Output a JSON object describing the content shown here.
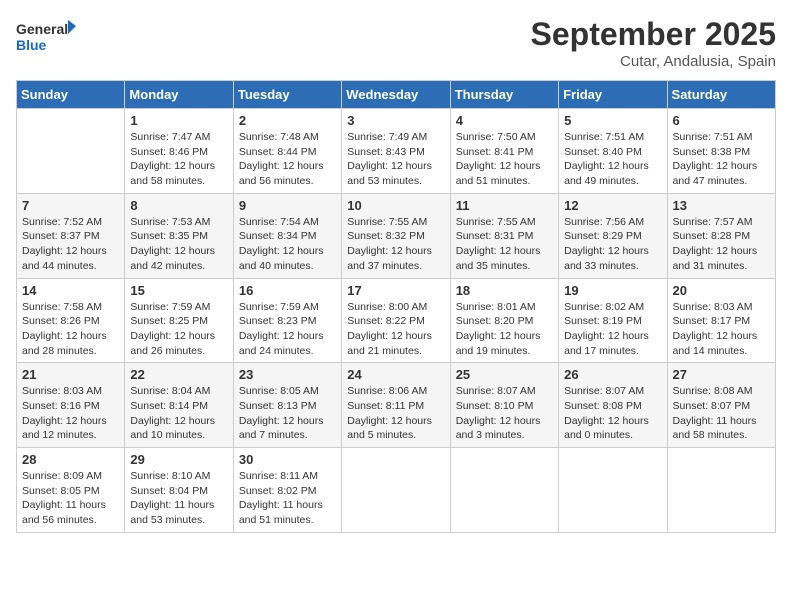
{
  "header": {
    "logo_line1": "General",
    "logo_line2": "Blue",
    "month_title": "September 2025",
    "location": "Cutar, Andalusia, Spain"
  },
  "weekdays": [
    "Sunday",
    "Monday",
    "Tuesday",
    "Wednesday",
    "Thursday",
    "Friday",
    "Saturday"
  ],
  "weeks": [
    [
      {
        "day": "",
        "sunrise": "",
        "sunset": "",
        "daylight": ""
      },
      {
        "day": "1",
        "sunrise": "Sunrise: 7:47 AM",
        "sunset": "Sunset: 8:46 PM",
        "daylight": "Daylight: 12 hours and 58 minutes."
      },
      {
        "day": "2",
        "sunrise": "Sunrise: 7:48 AM",
        "sunset": "Sunset: 8:44 PM",
        "daylight": "Daylight: 12 hours and 56 minutes."
      },
      {
        "day": "3",
        "sunrise": "Sunrise: 7:49 AM",
        "sunset": "Sunset: 8:43 PM",
        "daylight": "Daylight: 12 hours and 53 minutes."
      },
      {
        "day": "4",
        "sunrise": "Sunrise: 7:50 AM",
        "sunset": "Sunset: 8:41 PM",
        "daylight": "Daylight: 12 hours and 51 minutes."
      },
      {
        "day": "5",
        "sunrise": "Sunrise: 7:51 AM",
        "sunset": "Sunset: 8:40 PM",
        "daylight": "Daylight: 12 hours and 49 minutes."
      },
      {
        "day": "6",
        "sunrise": "Sunrise: 7:51 AM",
        "sunset": "Sunset: 8:38 PM",
        "daylight": "Daylight: 12 hours and 47 minutes."
      }
    ],
    [
      {
        "day": "7",
        "sunrise": "Sunrise: 7:52 AM",
        "sunset": "Sunset: 8:37 PM",
        "daylight": "Daylight: 12 hours and 44 minutes."
      },
      {
        "day": "8",
        "sunrise": "Sunrise: 7:53 AM",
        "sunset": "Sunset: 8:35 PM",
        "daylight": "Daylight: 12 hours and 42 minutes."
      },
      {
        "day": "9",
        "sunrise": "Sunrise: 7:54 AM",
        "sunset": "Sunset: 8:34 PM",
        "daylight": "Daylight: 12 hours and 40 minutes."
      },
      {
        "day": "10",
        "sunrise": "Sunrise: 7:55 AM",
        "sunset": "Sunset: 8:32 PM",
        "daylight": "Daylight: 12 hours and 37 minutes."
      },
      {
        "day": "11",
        "sunrise": "Sunrise: 7:55 AM",
        "sunset": "Sunset: 8:31 PM",
        "daylight": "Daylight: 12 hours and 35 minutes."
      },
      {
        "day": "12",
        "sunrise": "Sunrise: 7:56 AM",
        "sunset": "Sunset: 8:29 PM",
        "daylight": "Daylight: 12 hours and 33 minutes."
      },
      {
        "day": "13",
        "sunrise": "Sunrise: 7:57 AM",
        "sunset": "Sunset: 8:28 PM",
        "daylight": "Daylight: 12 hours and 31 minutes."
      }
    ],
    [
      {
        "day": "14",
        "sunrise": "Sunrise: 7:58 AM",
        "sunset": "Sunset: 8:26 PM",
        "daylight": "Daylight: 12 hours and 28 minutes."
      },
      {
        "day": "15",
        "sunrise": "Sunrise: 7:59 AM",
        "sunset": "Sunset: 8:25 PM",
        "daylight": "Daylight: 12 hours and 26 minutes."
      },
      {
        "day": "16",
        "sunrise": "Sunrise: 7:59 AM",
        "sunset": "Sunset: 8:23 PM",
        "daylight": "Daylight: 12 hours and 24 minutes."
      },
      {
        "day": "17",
        "sunrise": "Sunrise: 8:00 AM",
        "sunset": "Sunset: 8:22 PM",
        "daylight": "Daylight: 12 hours and 21 minutes."
      },
      {
        "day": "18",
        "sunrise": "Sunrise: 8:01 AM",
        "sunset": "Sunset: 8:20 PM",
        "daylight": "Daylight: 12 hours and 19 minutes."
      },
      {
        "day": "19",
        "sunrise": "Sunrise: 8:02 AM",
        "sunset": "Sunset: 8:19 PM",
        "daylight": "Daylight: 12 hours and 17 minutes."
      },
      {
        "day": "20",
        "sunrise": "Sunrise: 8:03 AM",
        "sunset": "Sunset: 8:17 PM",
        "daylight": "Daylight: 12 hours and 14 minutes."
      }
    ],
    [
      {
        "day": "21",
        "sunrise": "Sunrise: 8:03 AM",
        "sunset": "Sunset: 8:16 PM",
        "daylight": "Daylight: 12 hours and 12 minutes."
      },
      {
        "day": "22",
        "sunrise": "Sunrise: 8:04 AM",
        "sunset": "Sunset: 8:14 PM",
        "daylight": "Daylight: 12 hours and 10 minutes."
      },
      {
        "day": "23",
        "sunrise": "Sunrise: 8:05 AM",
        "sunset": "Sunset: 8:13 PM",
        "daylight": "Daylight: 12 hours and 7 minutes."
      },
      {
        "day": "24",
        "sunrise": "Sunrise: 8:06 AM",
        "sunset": "Sunset: 8:11 PM",
        "daylight": "Daylight: 12 hours and 5 minutes."
      },
      {
        "day": "25",
        "sunrise": "Sunrise: 8:07 AM",
        "sunset": "Sunset: 8:10 PM",
        "daylight": "Daylight: 12 hours and 3 minutes."
      },
      {
        "day": "26",
        "sunrise": "Sunrise: 8:07 AM",
        "sunset": "Sunset: 8:08 PM",
        "daylight": "Daylight: 12 hours and 0 minutes."
      },
      {
        "day": "27",
        "sunrise": "Sunrise: 8:08 AM",
        "sunset": "Sunset: 8:07 PM",
        "daylight": "Daylight: 11 hours and 58 minutes."
      }
    ],
    [
      {
        "day": "28",
        "sunrise": "Sunrise: 8:09 AM",
        "sunset": "Sunset: 8:05 PM",
        "daylight": "Daylight: 11 hours and 56 minutes."
      },
      {
        "day": "29",
        "sunrise": "Sunrise: 8:10 AM",
        "sunset": "Sunset: 8:04 PM",
        "daylight": "Daylight: 11 hours and 53 minutes."
      },
      {
        "day": "30",
        "sunrise": "Sunrise: 8:11 AM",
        "sunset": "Sunset: 8:02 PM",
        "daylight": "Daylight: 11 hours and 51 minutes."
      },
      {
        "day": "",
        "sunrise": "",
        "sunset": "",
        "daylight": ""
      },
      {
        "day": "",
        "sunrise": "",
        "sunset": "",
        "daylight": ""
      },
      {
        "day": "",
        "sunrise": "",
        "sunset": "",
        "daylight": ""
      },
      {
        "day": "",
        "sunrise": "",
        "sunset": "",
        "daylight": ""
      }
    ]
  ]
}
